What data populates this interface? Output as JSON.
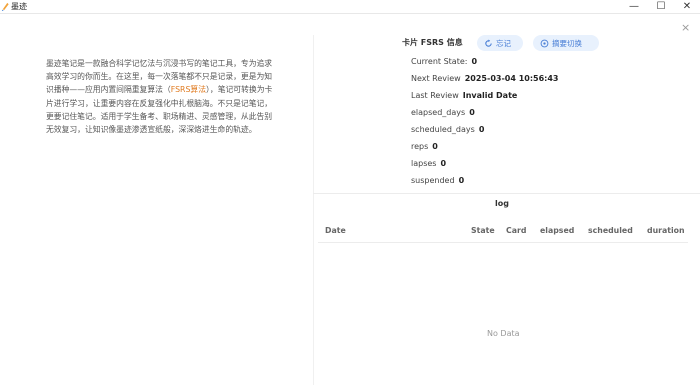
{
  "window": {
    "title": "墨迹",
    "minimize_glyph": "—",
    "maximize_glyph": "☐",
    "close_glyph": "✕"
  },
  "panel": {
    "close_glyph": "×"
  },
  "description": {
    "part1": "墨迹笔记是一款融合科学记忆法与沉浸书写的笔记工具，专为追求高效学习的你而生。在这里，每一次落笔都不只是记录，更是为知识播种——应用内置间隔重复算法（",
    "highlight": "FSRS算法",
    "part2": "），笔记可转换为卡片进行学习，让重要内容在反复强化中扎根脑海。不只是记笔记，更要记住笔记。适用于学生备考、职场精进、灵感管理，从此告别无效复习，让知识像墨迹渗透宣纸般，深深烙进生命的轨迹。"
  },
  "card_info": {
    "title": "卡片 FSRS 信息",
    "forget_button": "忘记",
    "swap_button": "摘要切换",
    "rows": [
      {
        "label": "Current State:",
        "value": "0"
      },
      {
        "label": "Next Review",
        "value": "2025-03-04 10:56:43"
      },
      {
        "label": "Last Review",
        "value": "Invalid Date"
      },
      {
        "label": "elapsed_days",
        "value": "0"
      },
      {
        "label": "scheduled_days",
        "value": "0"
      },
      {
        "label": "reps",
        "value": "0"
      },
      {
        "label": "lapses",
        "value": "0"
      },
      {
        "label": "suspended",
        "value": "0"
      }
    ]
  },
  "log": {
    "title": "log",
    "columns": [
      "Date",
      "State",
      "Card",
      "elapsed",
      "scheduled",
      "duration"
    ],
    "empty_text": "No Data"
  },
  "colors": {
    "accent": "#4a7fd6",
    "pill_bg": "#e8f1fd",
    "highlight": "#e07a1f"
  }
}
